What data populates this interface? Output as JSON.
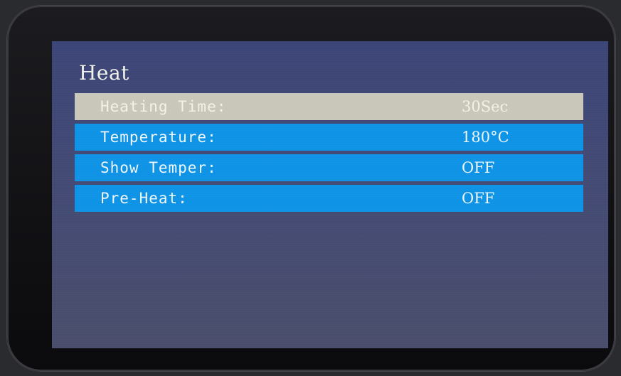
{
  "screen": {
    "title": "Heat"
  },
  "menu": {
    "items": [
      {
        "label": "Heating Time:",
        "value": "30Sec",
        "selected": true
      },
      {
        "label": "Temperature:",
        "value": "180°C",
        "selected": false
      },
      {
        "label": "Show Temper:",
        "value": "OFF",
        "selected": false
      },
      {
        "label": "Pre-Heat:",
        "value": "OFF",
        "selected": false
      }
    ]
  },
  "colors": {
    "row_background": "#0f93e6",
    "selected_row_background": "#c9c6ba",
    "screen_background": "#3f4774"
  }
}
